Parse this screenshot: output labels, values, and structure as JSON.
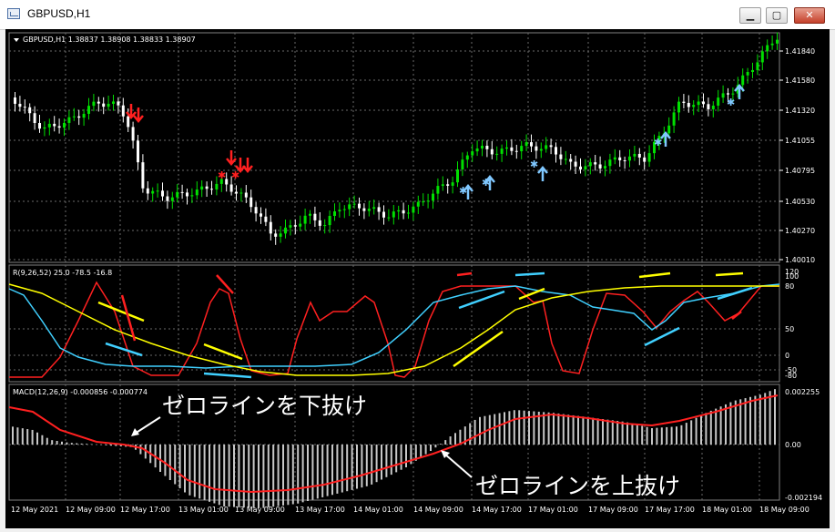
{
  "window": {
    "title": "GBPUSD,H1",
    "min_icon": "minimize-icon",
    "max_icon": "maximize-icon",
    "close_icon": "close-icon"
  },
  "main_panel": {
    "header": "GBPUSD,H1  1.38837 1.38908 1.38833 1.38907",
    "price_axis": [
      "1.41840",
      "1.41580",
      "1.41320",
      "1.41055",
      "1.40795",
      "1.40530",
      "1.40270",
      "1.40010"
    ]
  },
  "rci_panel": {
    "header": "R(9,26,52) 25.0 -78.5 -16.8",
    "axis": [
      "120",
      "100",
      "80",
      "50",
      "0",
      "-50",
      "-80",
      "-100"
    ]
  },
  "macd_panel": {
    "header": "MACD(12,26,9) -0.000856 -0.000774",
    "axis": [
      "0.002255",
      "0.00",
      "-0.002194"
    ],
    "annotation_down": "ゼロラインを下抜け",
    "annotation_up": "ゼロラインを上抜け"
  },
  "time_axis": [
    "12 May 2021",
    "12 May 09:00",
    "12 May 17:00",
    "13 May 01:00",
    "13 May 09:00",
    "13 May 17:00",
    "14 May 01:00",
    "14 May 09:00",
    "14 May 17:00",
    "17 May 01:00",
    "17 May 09:00",
    "17 May 17:00",
    "18 May 01:00",
    "18 May 09:00"
  ],
  "colors": {
    "candle_up": "#00e000",
    "candle_down": "#ffffff",
    "rci_short": "#ff2020",
    "rci_mid": "#40d0ff",
    "rci_long": "#ffff00",
    "macd_signal": "#ff2020",
    "macd_hist": "#c8c8c8",
    "sell_arrow": "#ff2020",
    "buy_arrow": "#80c8ff"
  }
}
